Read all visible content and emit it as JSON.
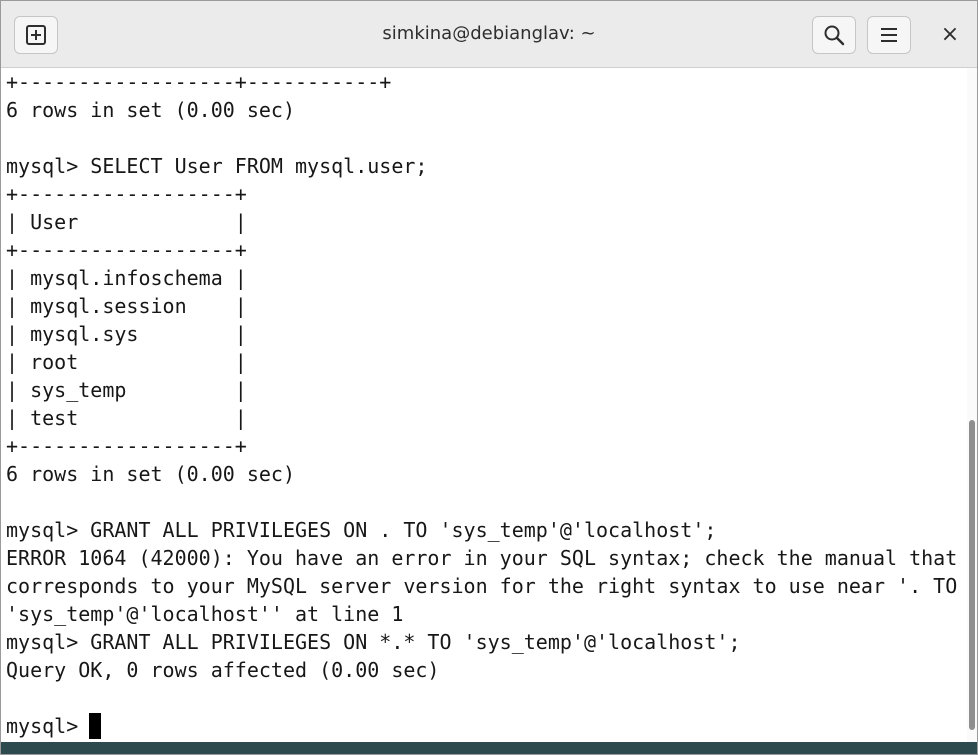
{
  "window": {
    "title": "simkina@debianglav: ~",
    "new_tab_icon": "new-tab-icon",
    "search_icon": "search-icon",
    "menu_icon": "hamburger-menu-icon",
    "close_label": "×"
  },
  "terminal": {
    "lines": [
      "+------------------+-----------+",
      "6 rows in set (0.00 sec)",
      "",
      "mysql> SELECT User FROM mysql.user;",
      "+------------------+",
      "| User             |",
      "+------------------+",
      "| mysql.infoschema |",
      "| mysql.session    |",
      "| mysql.sys        |",
      "| root             |",
      "| sys_temp         |",
      "| test             |",
      "+------------------+",
      "6 rows in set (0.00 sec)",
      "",
      "mysql> GRANT ALL PRIVILEGES ON . TO 'sys_temp'@'localhost';",
      "ERROR 1064 (42000): You have an error in your SQL syntax; check the manual that",
      "corresponds to your MySQL server version for the right syntax to use near '. TO",
      "'sys_temp'@'localhost'' at line 1",
      "mysql> GRANT ALL PRIVILEGES ON *.* TO 'sys_temp'@'localhost';",
      "Query OK, 0 rows affected (0.00 sec)",
      "",
      "mysql> "
    ]
  }
}
